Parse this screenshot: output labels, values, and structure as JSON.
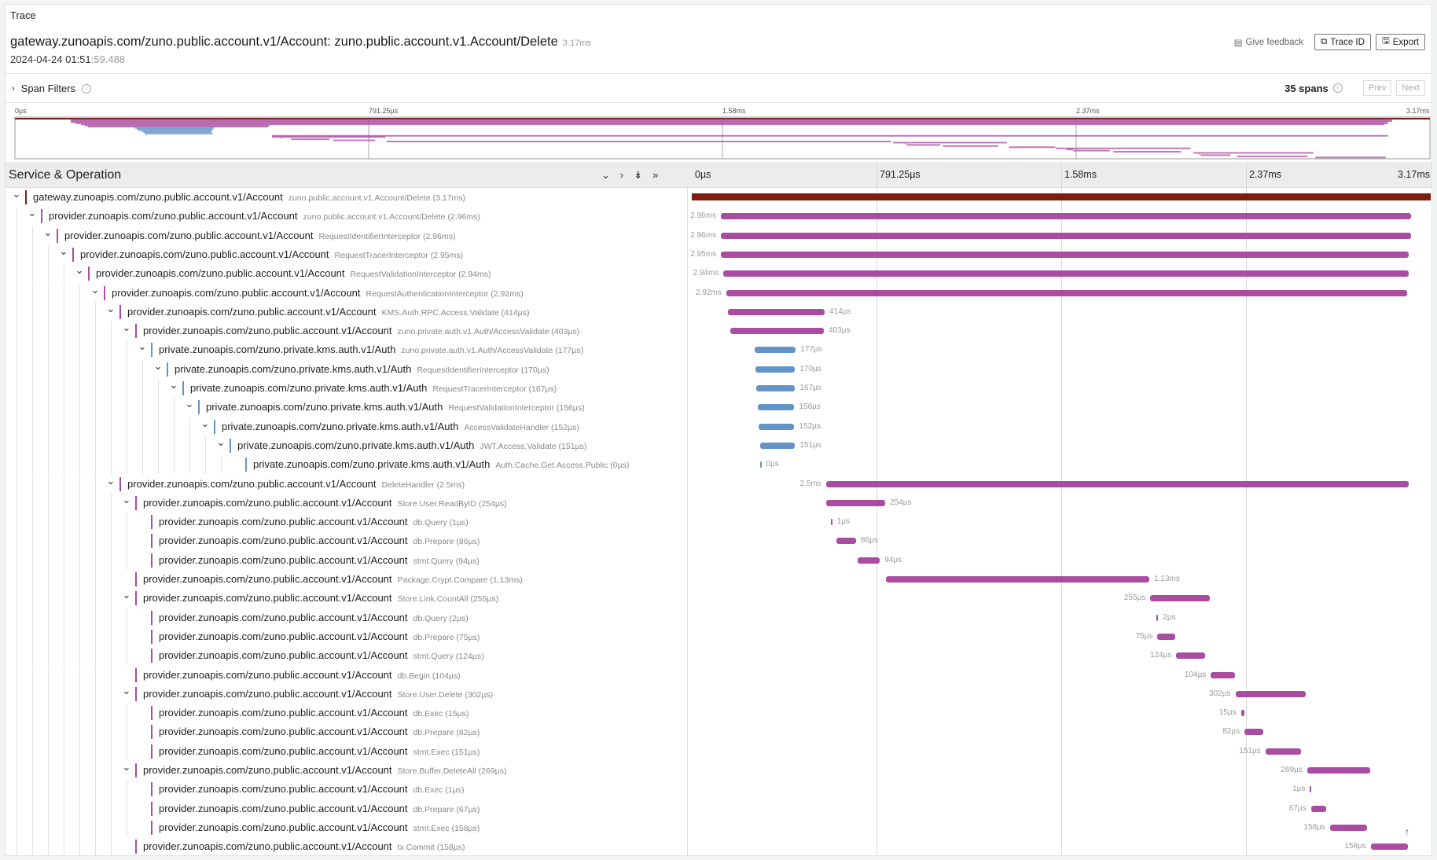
{
  "header": {
    "breadcrumb": "Trace",
    "title": "gateway.zunoapis.com/zuno.public.account.v1/Account: zuno.public.account.v1.Account/Delete",
    "duration": "3.17ms",
    "date": "2024-04-24 01:51",
    "date_ms": ":59.488",
    "feedback": "Give feedback",
    "trace_id": "Trace ID",
    "export": "Export"
  },
  "filters": {
    "label": "Span Filters",
    "span_count": "35 spans",
    "prev": "Prev",
    "next": "Next"
  },
  "table": {
    "header": "Service & Operation",
    "ticks": [
      "0µs",
      "791.25µs",
      "1.58ms",
      "2.37ms",
      "3.17ms"
    ]
  },
  "colors": {
    "gateway": "#7e1c12",
    "provider": "#a94ca2",
    "private": "#6394c8"
  },
  "total_us": 3170,
  "spans": [
    {
      "service": "gateway.zunoapis.com/zuno.public.account.v1/Account",
      "op": "zuno.public.account.v1.Account/Delete (3.17ms)",
      "label": "",
      "start": 0,
      "dur": 3170,
      "depth": 0,
      "kids": true,
      "kind": "gateway"
    },
    {
      "service": "provider.zunoapis.com/zuno.public.account.v1/Account",
      "op": "zuno.public.account.v1.Account/Delete (2.96ms)",
      "label": "2.96ms",
      "start": 125,
      "dur": 2960,
      "depth": 1,
      "kids": true,
      "kind": "provider"
    },
    {
      "service": "provider.zunoapis.com/zuno.public.account.v1/Account",
      "op": "RequestIdentifierInterceptor (2.96ms)",
      "label": "2.96ms",
      "start": 125,
      "dur": 2960,
      "depth": 2,
      "kids": true,
      "kind": "provider"
    },
    {
      "service": "provider.zunoapis.com/zuno.public.account.v1/Account",
      "op": "RequestTracerInterceptor (2.95ms)",
      "label": "2.95ms",
      "start": 125,
      "dur": 2950,
      "depth": 3,
      "kids": true,
      "kind": "provider"
    },
    {
      "service": "provider.zunoapis.com/zuno.public.account.v1/Account",
      "op": "RequestValidationInterceptor (2.94ms)",
      "label": "2.94ms",
      "start": 136,
      "dur": 2940,
      "depth": 4,
      "kids": true,
      "kind": "provider"
    },
    {
      "service": "provider.zunoapis.com/zuno.public.account.v1/Account",
      "op": "RequestAuthenticationInterceptor (2.92ms)",
      "label": "2.92ms",
      "start": 148,
      "dur": 2920,
      "depth": 5,
      "kids": true,
      "kind": "provider"
    },
    {
      "service": "provider.zunoapis.com/zuno.public.account.v1/Account",
      "op": "KMS.Auth.RPC.Access.Validate (414µs)",
      "label": "414µs",
      "start": 156,
      "dur": 414,
      "depth": 6,
      "kids": true,
      "kind": "provider"
    },
    {
      "service": "provider.zunoapis.com/zuno.public.account.v1/Account",
      "op": "zuno.private.auth.v1.Auth/AccessValidate (403µs)",
      "label": "403µs",
      "start": 164,
      "dur": 403,
      "depth": 7,
      "kids": true,
      "kind": "provider"
    },
    {
      "service": "private.zunoapis.com/zuno.private.kms.auth.v1/Auth",
      "op": "zuno.private.auth.v1.Auth/AccessValidate (177µs)",
      "label": "177µs",
      "start": 269,
      "dur": 177,
      "depth": 8,
      "kids": true,
      "kind": "private"
    },
    {
      "service": "private.zunoapis.com/zuno.private.kms.auth.v1/Auth",
      "op": "RequestIdentifierInterceptor (170µs)",
      "label": "170µs",
      "start": 273,
      "dur": 170,
      "depth": 9,
      "kids": true,
      "kind": "private"
    },
    {
      "service": "private.zunoapis.com/zuno.private.kms.auth.v1/Auth",
      "op": "RequestTracerInterceptor (167µs)",
      "label": "167µs",
      "start": 276,
      "dur": 167,
      "depth": 10,
      "kids": true,
      "kind": "private"
    },
    {
      "service": "private.zunoapis.com/zuno.private.kms.auth.v1/Auth",
      "op": "RequestValidationInterceptor (156µs)",
      "label": "156µs",
      "start": 284,
      "dur": 156,
      "depth": 11,
      "kids": true,
      "kind": "private"
    },
    {
      "service": "private.zunoapis.com/zuno.private.kms.auth.v1/Auth",
      "op": "AccessValidateHandler (152µs)",
      "label": "152µs",
      "start": 288,
      "dur": 152,
      "depth": 12,
      "kids": true,
      "kind": "private"
    },
    {
      "service": "private.zunoapis.com/zuno.private.kms.auth.v1/Auth",
      "op": "JWT.Access.Validate (151µs)",
      "label": "151µs",
      "start": 292,
      "dur": 151,
      "depth": 13,
      "kids": true,
      "kind": "private"
    },
    {
      "service": "private.zunoapis.com/zuno.private.kms.auth.v1/Auth",
      "op": "Auth.Cache.Get.Access.Public (0µs)",
      "label": "0µs",
      "start": 292,
      "dur": 0,
      "depth": 14,
      "kids": false,
      "kind": "private"
    },
    {
      "service": "provider.zunoapis.com/zuno.public.account.v1/Account",
      "op": "DeleteHandler (2.5ms)",
      "label": "2.5ms",
      "start": 576,
      "dur": 2500,
      "depth": 6,
      "kids": true,
      "kind": "provider"
    },
    {
      "service": "provider.zunoapis.com/zuno.public.account.v1/Account",
      "op": "Store.User.ReadByID (254µs)",
      "label": "254µs",
      "start": 576,
      "dur": 254,
      "depth": 7,
      "kids": true,
      "kind": "provider"
    },
    {
      "service": "provider.zunoapis.com/zuno.public.account.v1/Account",
      "op": "db.Query (1µs)",
      "label": "1µs",
      "start": 596,
      "dur": 1,
      "depth": 8,
      "kids": false,
      "kind": "provider"
    },
    {
      "service": "provider.zunoapis.com/zuno.public.account.v1/Account",
      "op": "db.Prepare (86µs)",
      "label": "86µs",
      "start": 619,
      "dur": 86,
      "depth": 8,
      "kids": false,
      "kind": "provider"
    },
    {
      "service": "provider.zunoapis.com/zuno.public.account.v1/Account",
      "op": "stmt.Query (94µs)",
      "label": "94µs",
      "start": 713,
      "dur": 94,
      "depth": 8,
      "kids": false,
      "kind": "provider"
    },
    {
      "service": "provider.zunoapis.com/zuno.public.account.v1/Account",
      "op": "Package.Crypt.Compare (1.13ms)",
      "label": "1.13ms",
      "start": 833,
      "dur": 1130,
      "depth": 7,
      "kids": false,
      "kind": "provider"
    },
    {
      "service": "provider.zunoapis.com/zuno.public.account.v1/Account",
      "op": "Store.Link.CountAll (255µs)",
      "label": "255µs",
      "start": 1967,
      "dur": 255,
      "depth": 7,
      "kids": true,
      "kind": "provider"
    },
    {
      "service": "provider.zunoapis.com/zuno.public.account.v1/Account",
      "op": "db.Query (2µs)",
      "label": "2µs",
      "start": 1994,
      "dur": 2,
      "depth": 8,
      "kids": false,
      "kind": "provider"
    },
    {
      "service": "provider.zunoapis.com/zuno.public.account.v1/Account",
      "op": "db.Prepare (75µs)",
      "label": "75µs",
      "start": 1998,
      "dur": 75,
      "depth": 8,
      "kids": false,
      "kind": "provider"
    },
    {
      "service": "provider.zunoapis.com/zuno.public.account.v1/Account",
      "op": "stmt.Query (124µs)",
      "label": "124µs",
      "start": 2079,
      "dur": 124,
      "depth": 8,
      "kids": false,
      "kind": "provider"
    },
    {
      "service": "provider.zunoapis.com/zuno.public.account.v1/Account",
      "op": "db.Begin (104µs)",
      "label": "104µs",
      "start": 2227,
      "dur": 104,
      "depth": 7,
      "kids": false,
      "kind": "provider"
    },
    {
      "service": "provider.zunoapis.com/zuno.public.account.v1/Account",
      "op": "Store.User.Delete (302µs)",
      "label": "302µs",
      "start": 2332,
      "dur": 302,
      "depth": 7,
      "kids": true,
      "kind": "provider"
    },
    {
      "service": "provider.zunoapis.com/zuno.public.account.v1/Account",
      "op": "db.Exec (15µs)",
      "label": "15µs",
      "start": 2356,
      "dur": 15,
      "depth": 8,
      "kids": false,
      "kind": "provider"
    },
    {
      "service": "provider.zunoapis.com/zuno.public.account.v1/Account",
      "op": "db.Prepare (82µs)",
      "label": "82µs",
      "start": 2371,
      "dur": 82,
      "depth": 8,
      "kids": false,
      "kind": "provider"
    },
    {
      "service": "provider.zunoapis.com/zuno.public.account.v1/Account",
      "op": "stmt.Exec (151µs)",
      "label": "151µs",
      "start": 2461,
      "dur": 151,
      "depth": 8,
      "kids": false,
      "kind": "provider"
    },
    {
      "service": "provider.zunoapis.com/zuno.public.account.v1/Account",
      "op": "Store.Buffer.DeleteAll (269µs)",
      "label": "269µs",
      "start": 2640,
      "dur": 269,
      "depth": 7,
      "kids": true,
      "kind": "provider"
    },
    {
      "service": "provider.zunoapis.com/zuno.public.account.v1/Account",
      "op": "db.Exec (1µs)",
      "label": "1µs",
      "start": 2652,
      "dur": 1,
      "depth": 8,
      "kids": false,
      "kind": "provider"
    },
    {
      "service": "provider.zunoapis.com/zuno.public.account.v1/Account",
      "op": "db.Prepare (67µs)",
      "label": "67µs",
      "start": 2656,
      "dur": 67,
      "depth": 8,
      "kids": false,
      "kind": "provider"
    },
    {
      "service": "provider.zunoapis.com/zuno.public.account.v1/Account",
      "op": "stmt.Exec (158µs)",
      "label": "158µs",
      "start": 2738,
      "dur": 158,
      "depth": 8,
      "kids": false,
      "kind": "provider"
    },
    {
      "service": "provider.zunoapis.com/zuno.public.account.v1/Account",
      "op": "tx.Commit (158µs)",
      "label": "158µs",
      "start": 2913,
      "dur": 158,
      "depth": 7,
      "kids": false,
      "kind": "provider"
    }
  ]
}
